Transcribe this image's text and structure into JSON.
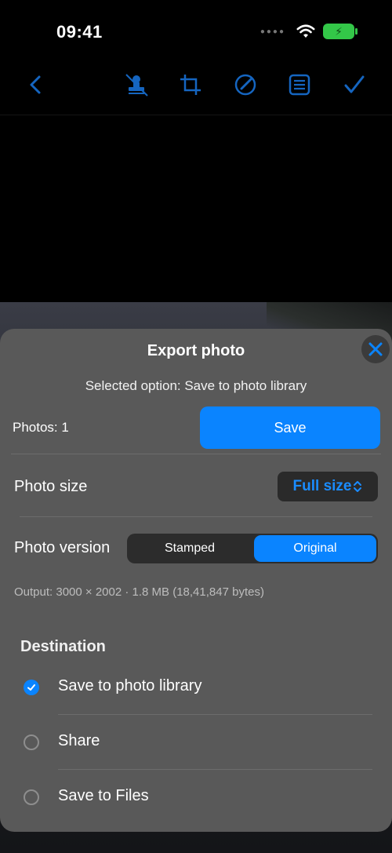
{
  "status_bar": {
    "time": "09:41"
  },
  "toolbar": {
    "icons": [
      "back-icon",
      "stamp-off-icon",
      "crop-icon",
      "edit-icon",
      "notes-icon",
      "done-checkmark-icon"
    ]
  },
  "export_sheet": {
    "title": "Export photo",
    "selected_option_text": "Selected option: Save to photo library",
    "photos_count_label": "Photos: 1",
    "save_button_label": "Save",
    "photo_size": {
      "label": "Photo size",
      "value": "Full size"
    },
    "photo_version": {
      "label": "Photo version",
      "options": [
        "Stamped",
        "Original"
      ],
      "selected": "Original"
    },
    "output_text": "Output: 3000 × 2002 · 1.8 MB (18,41,847 bytes)",
    "destination": {
      "title": "Destination",
      "options": [
        {
          "label": "Save to photo library",
          "checked": true
        },
        {
          "label": "Share",
          "checked": false
        },
        {
          "label": "Save to Files",
          "checked": false
        }
      ]
    }
  },
  "colors": {
    "accent": "#0a84ff",
    "sheet_bg": "#595959",
    "battery": "#33c748"
  }
}
